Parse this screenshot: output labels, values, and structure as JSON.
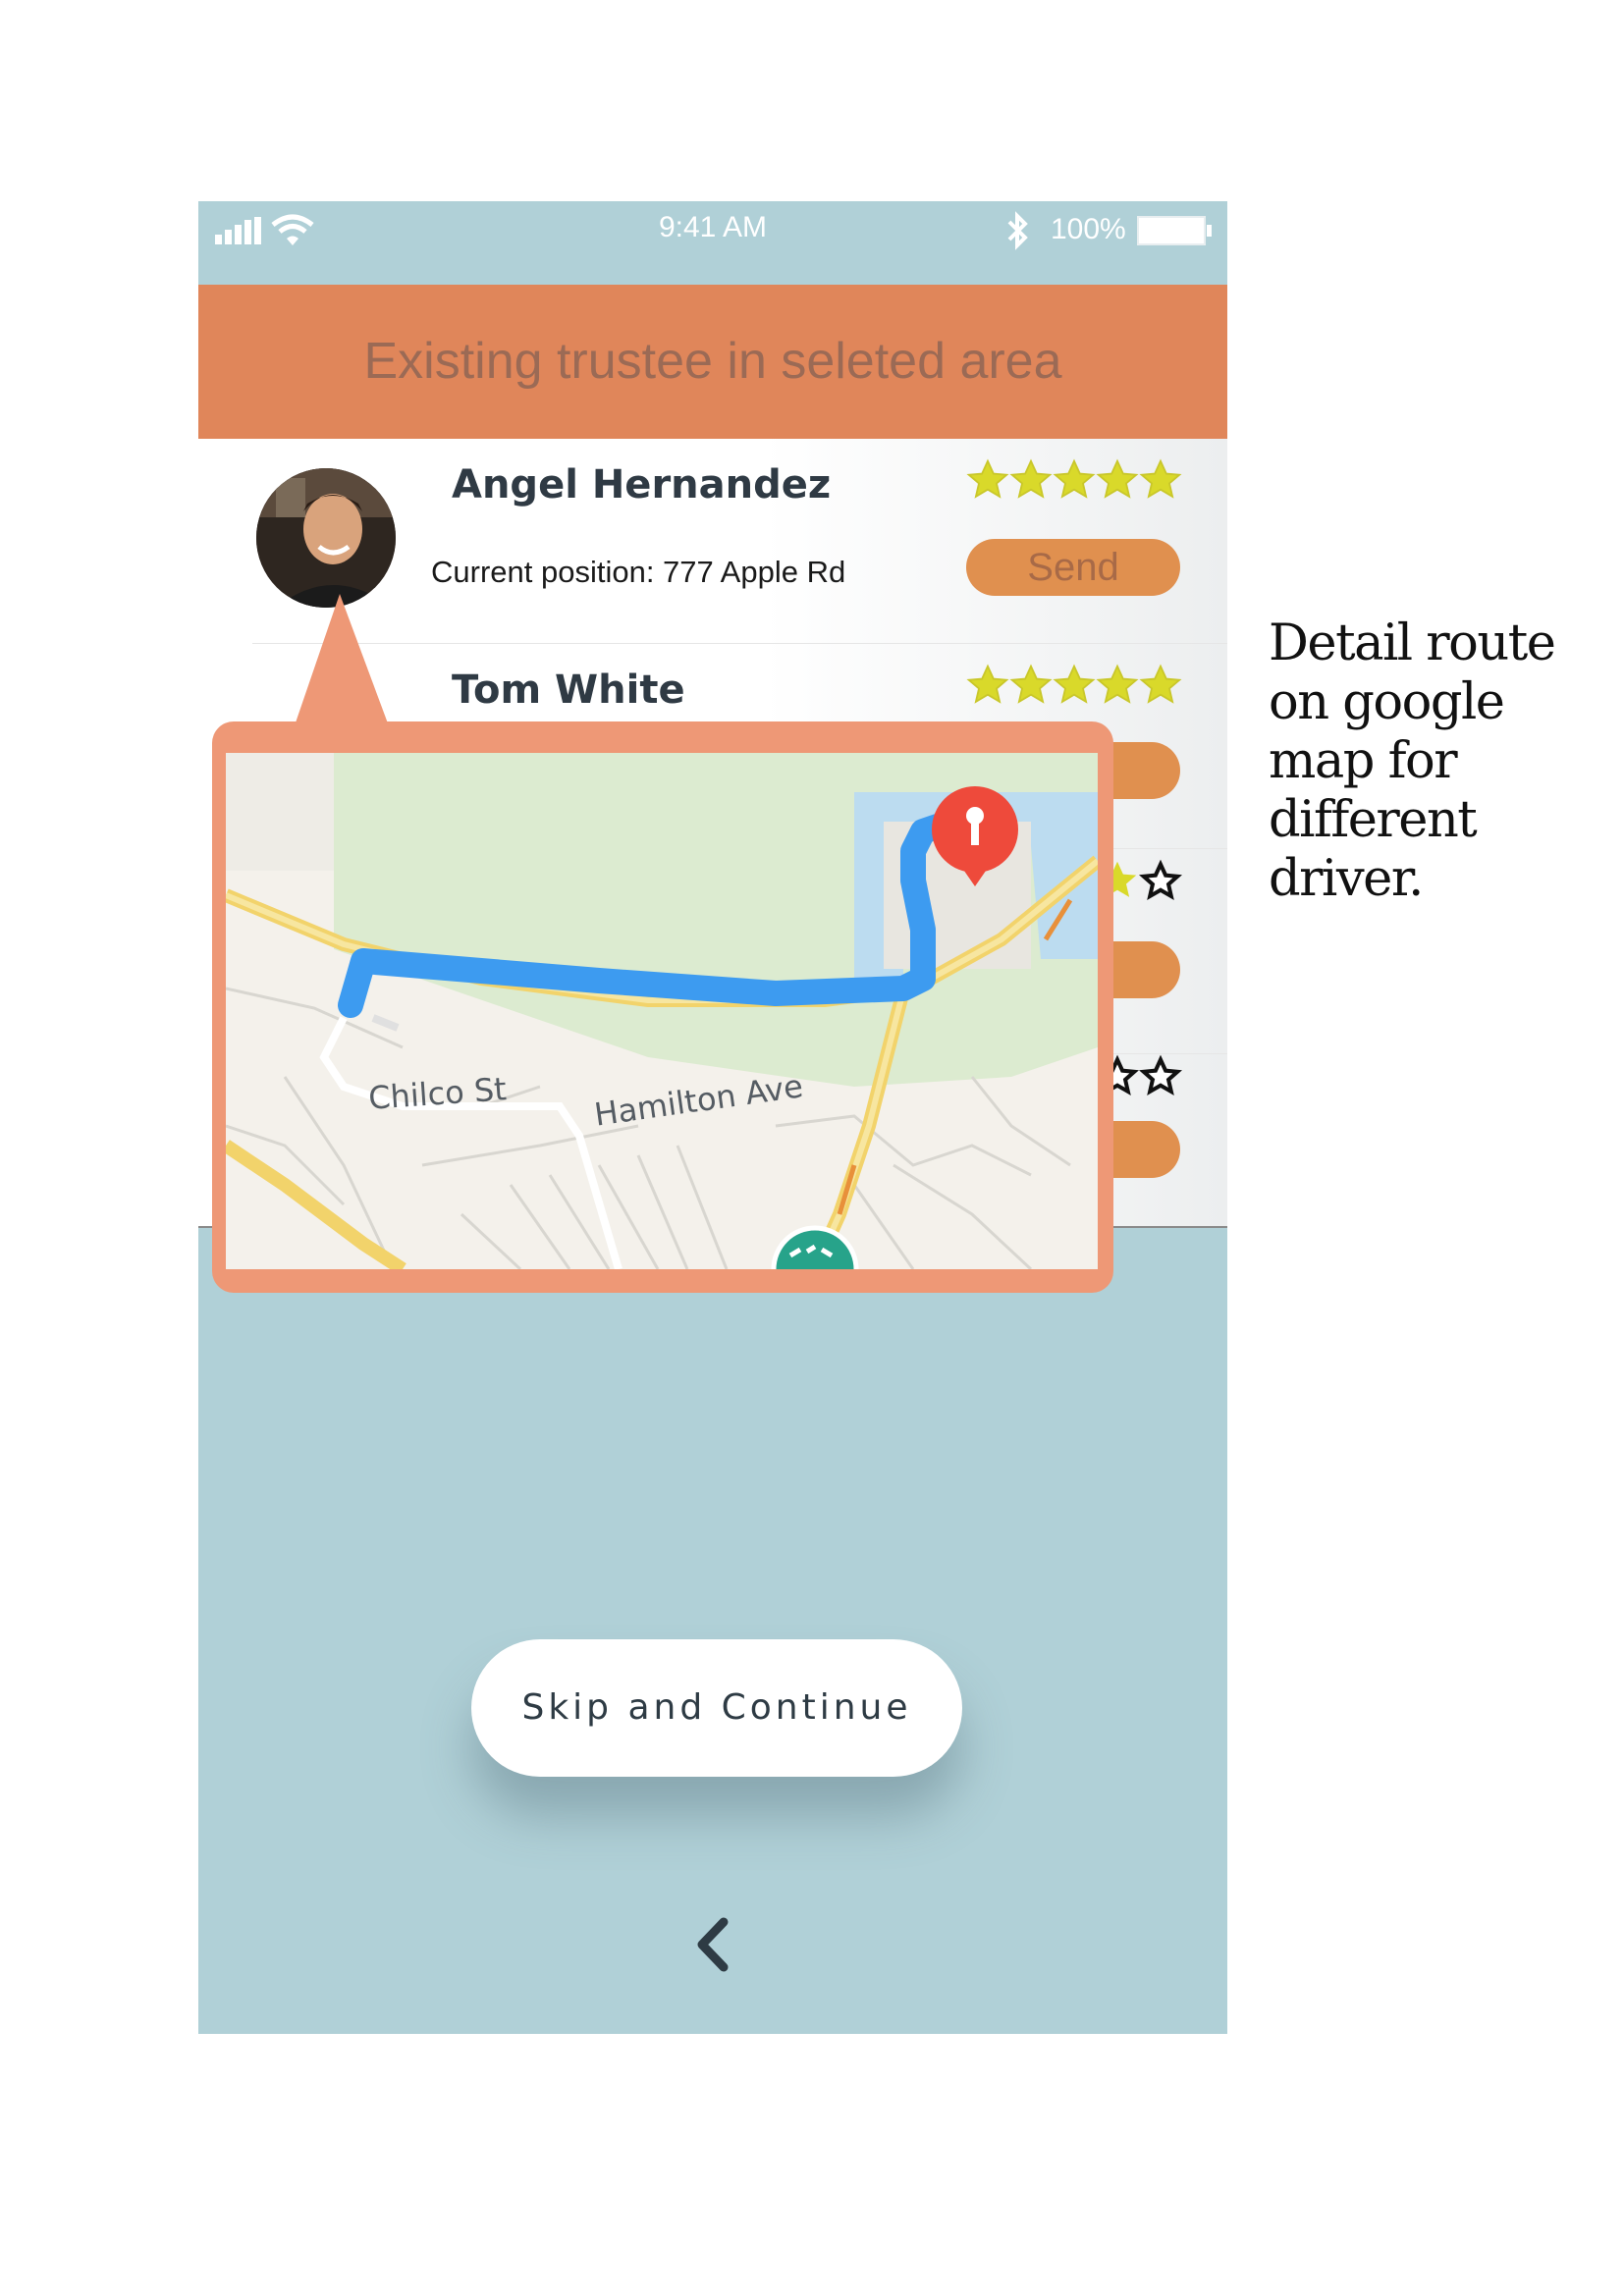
{
  "status_bar": {
    "time": "9:41 AM",
    "battery": "100%",
    "icons": [
      "signal-icon",
      "wifi-icon",
      "bluetooth-icon",
      "battery-icon"
    ]
  },
  "header": {
    "title": "Existing trustee in seleted area"
  },
  "trustees": [
    {
      "name": "Angel Hernandez",
      "position": "Current position: 777 Apple Rd",
      "rating": 5,
      "send_label": "Send"
    },
    {
      "name": "Tom White",
      "rating": 5
    }
  ],
  "map_popup": {
    "streets": [
      "Chilco St",
      "Hamilton Ave"
    ],
    "marker": "location-pin-icon"
  },
  "annotation": "Detail route\non google\nmap for\ndifferent\ndriver.",
  "bottom": {
    "skip_label": "Skip and Continue",
    "back_icon": "chevron-left-icon"
  },
  "colors": {
    "phone_bg": "#b0d0d7",
    "header_bg": "#e0865a",
    "send_button": "#e0904f",
    "star": "#d9d92a",
    "route": "#3d9bf0"
  }
}
